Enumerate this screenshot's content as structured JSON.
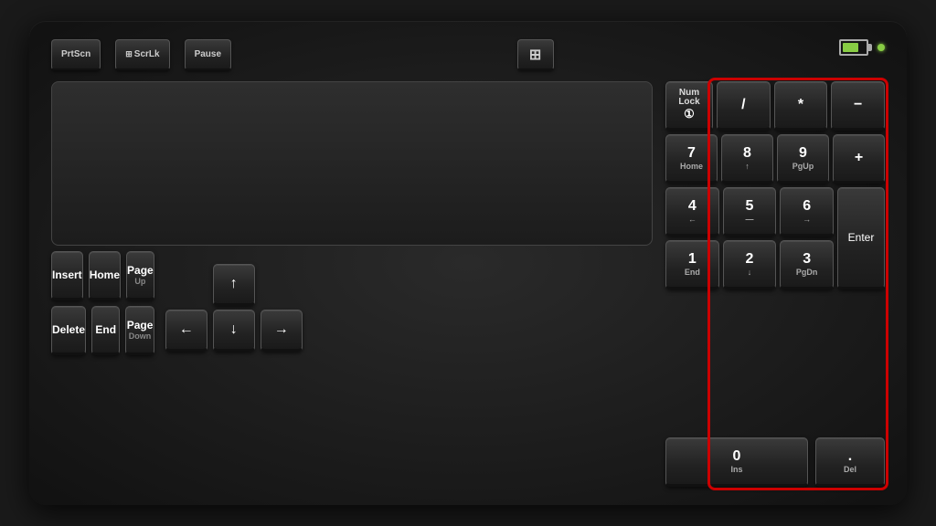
{
  "keyboard": {
    "top_keys": {
      "prtscn": "PrtScn",
      "scrlk": "ScrLk",
      "pause": "Pause",
      "calculator": "⊞"
    },
    "nav_cluster": {
      "row1": [
        {
          "main": "Insert",
          "sub": ""
        },
        {
          "main": "Home",
          "sub": ""
        },
        {
          "main": "Page",
          "sub": "Up"
        }
      ],
      "row2": [
        {
          "main": "Delete",
          "sub": ""
        },
        {
          "main": "End",
          "sub": ""
        },
        {
          "main": "Page",
          "sub": "Down"
        }
      ]
    },
    "arrow_keys": {
      "up": "↑",
      "left": "←",
      "down": "↓",
      "right": "→"
    },
    "numpad": {
      "numlock": {
        "line1": "Num",
        "line2": "Lock",
        "symbol": "①"
      },
      "divide": "/",
      "multiply": "*",
      "minus": "−",
      "seven": {
        "main": "7",
        "sub": "Home"
      },
      "eight": {
        "main": "8",
        "sub": "↑"
      },
      "nine": {
        "main": "9",
        "sub": "PgUp"
      },
      "plus": "+",
      "four": {
        "main": "4",
        "sub": "←"
      },
      "five": {
        "main": "5",
        "sub": "—"
      },
      "six": {
        "main": "6",
        "sub": "→"
      },
      "one": {
        "main": "1",
        "sub": "End"
      },
      "two": {
        "main": "2",
        "sub": "↓"
      },
      "three": {
        "main": "3",
        "sub": "PgDn"
      },
      "enter": "Enter",
      "zero": {
        "main": "0",
        "sub": "Ins"
      },
      "decimal": {
        "main": ".",
        "sub": "Del"
      }
    },
    "highlight_color": "#cc0000"
  }
}
